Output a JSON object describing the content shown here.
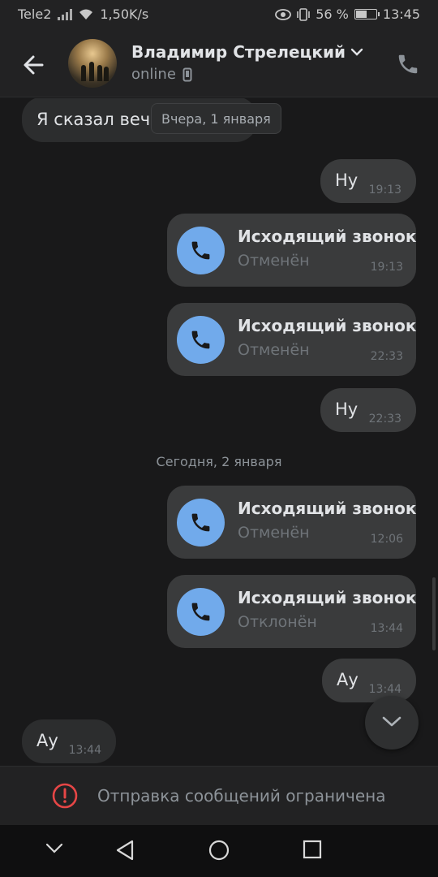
{
  "status_bar": {
    "carrier": "Tele2",
    "speed": "1,50K/s",
    "battery": "56 %",
    "battery_level": 0.56,
    "time": "13:45"
  },
  "header": {
    "name": "Владимир Стрелецкий",
    "status": "online",
    "icons": [
      "back-arrow-icon",
      "chevron-down-icon",
      "mobile-icon",
      "phone-icon"
    ]
  },
  "chat": {
    "partial_message": {
      "text": "Я сказал веч"
    },
    "date_chip": "Вчера, 1 января",
    "date_separator_today": "Сегодня, 2 января",
    "messages": [
      {
        "type": "text",
        "dir": "out",
        "text": "Ну",
        "time": "19:13"
      },
      {
        "type": "call",
        "dir": "out",
        "title": "Исходящий звонок",
        "status": "Отменён",
        "time": "19:13"
      },
      {
        "type": "call",
        "dir": "out",
        "title": "Исходящий звонок",
        "status": "Отменён",
        "time": "22:33"
      },
      {
        "type": "text",
        "dir": "out",
        "text": "Ну",
        "time": "22:33"
      },
      {
        "type": "call",
        "dir": "out",
        "title": "Исходящий звонок",
        "status": "Отменён",
        "time": "12:06"
      },
      {
        "type": "call",
        "dir": "out",
        "title": "Исходящий звонок",
        "status": "Отклонён",
        "time": "13:44"
      },
      {
        "type": "text",
        "dir": "out",
        "text": "Ау",
        "time": "13:44"
      },
      {
        "type": "text",
        "dir": "in",
        "text": "Ау",
        "time": "13:44"
      }
    ]
  },
  "restriction": {
    "text": "Отправка сообщений ограничена",
    "icon": "alert-circle-icon",
    "color": "#e64646"
  },
  "colors": {
    "accent": "#71aaeb",
    "background": "#19191a",
    "bubble_out": "#3a3b3c",
    "bubble_in": "#2c2d2e"
  }
}
